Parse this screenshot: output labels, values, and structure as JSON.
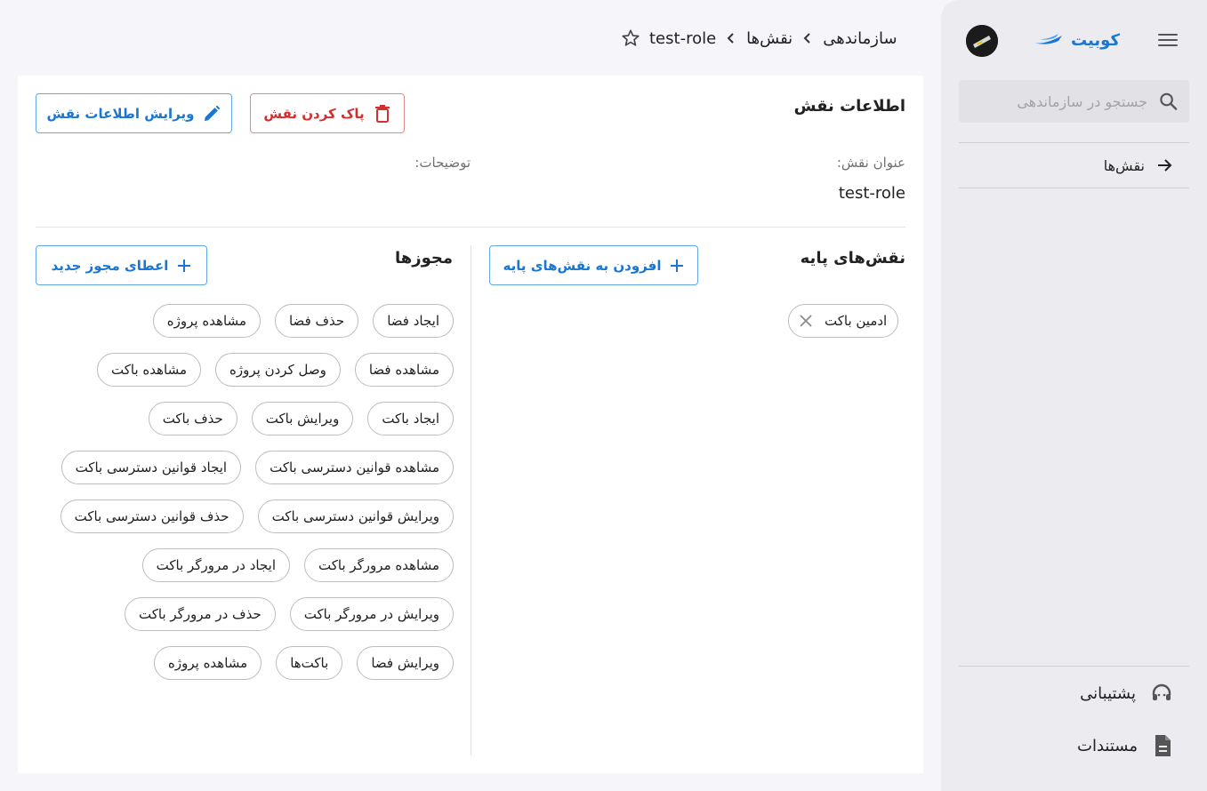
{
  "sidebar": {
    "logo_text": "کوبیت",
    "search_placeholder": "جستجو در سازماندهی",
    "nav_items": [
      {
        "label": "نقش‌ها"
      }
    ],
    "bottom_items": [
      {
        "label": "پشتیبانی"
      },
      {
        "label": "مستندات"
      }
    ],
    "accent_color": "#1976d2"
  },
  "breadcrumb": {
    "items": [
      "سازماندهی",
      "نقش‌ها",
      "test-role"
    ]
  },
  "role_info": {
    "title": "اطلاعات نقش",
    "delete_label": "پاک کردن نقش",
    "edit_label": "ویرایش اطلاعات نقش",
    "name_label": "عنوان نقش:",
    "name_value": "test-role",
    "description_label": "توضیحات:"
  },
  "base_roles": {
    "title": "نقش‌های پایه",
    "add_label": "افزودن به نقش‌های پایه",
    "items": [
      "ادمین باکت"
    ]
  },
  "permissions": {
    "title": "مجوزها",
    "add_label": "اعطای مجوز جدید",
    "items": [
      "ایجاد فضا",
      "حذف فضا",
      "مشاهده پروژه",
      "مشاهده فضا",
      "وصل کردن پروژه",
      "مشاهده باکت",
      "ایجاد باکت",
      "ویرایش باکت",
      "حذف باکت",
      "مشاهده قوانین دسترسی باکت",
      "ایجاد قوانین دسترسی باکت",
      "ویرایش قوانین دسترسی باکت",
      "حذف قوانین دسترسی باکت",
      "مشاهده مرورگر باکت",
      "ایجاد در مرورگر باکت",
      "ویرایش در مرورگر باکت",
      "حذف در مرورگر باکت",
      "ویرایش فضا",
      "باکت‌ها",
      "مشاهده پروژه"
    ]
  }
}
